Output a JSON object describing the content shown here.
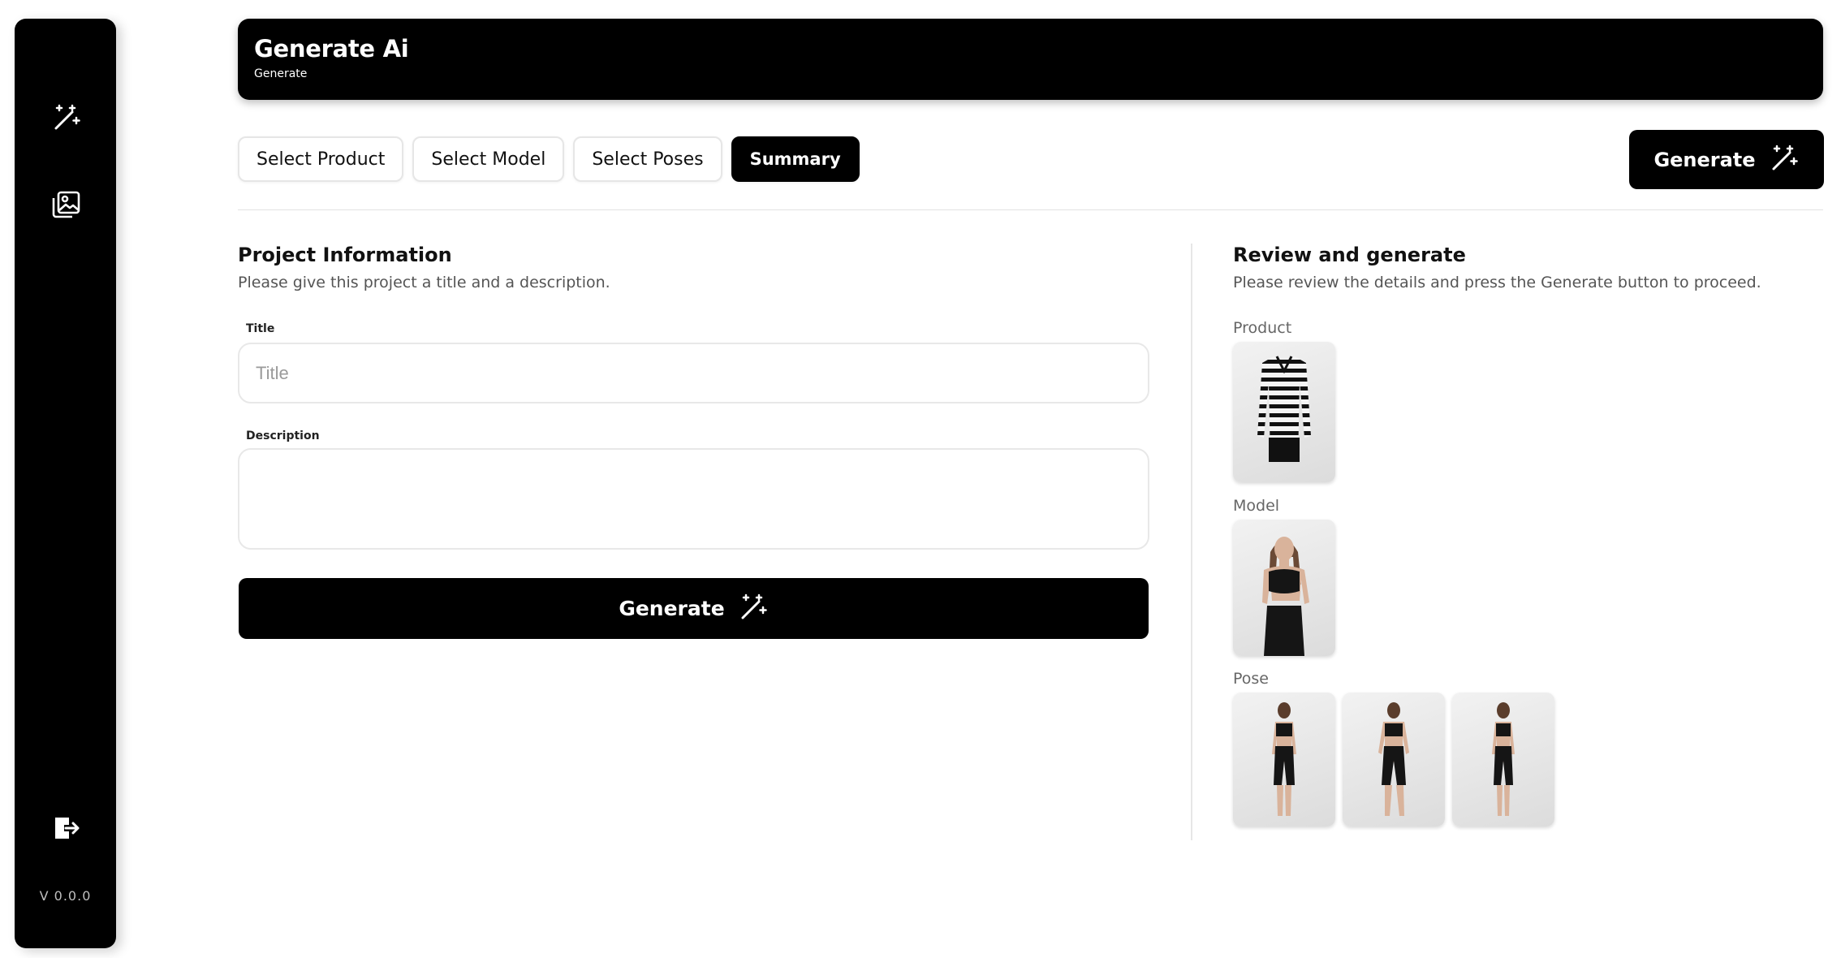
{
  "sidebar": {
    "items": [
      {
        "icon": "magic-wand-icon"
      },
      {
        "icon": "image-gallery-icon"
      }
    ],
    "logout_icon": "logout-icon",
    "version": "V 0.0.0"
  },
  "header": {
    "title": "Generate Ai",
    "subtitle": "Generate"
  },
  "tabs": [
    {
      "label": "Select Product",
      "active": false
    },
    {
      "label": "Select Model",
      "active": false
    },
    {
      "label": "Select Poses",
      "active": false
    },
    {
      "label": "Summary",
      "active": true
    }
  ],
  "toolbar": {
    "generate_label": "Generate"
  },
  "project_info": {
    "title": "Project Information",
    "subtitle": "Please give this project a title and a description.",
    "title_label": "Title",
    "title_placeholder": "Title",
    "title_value": "",
    "description_label": "Description",
    "description_value": "",
    "generate_label": "Generate"
  },
  "review": {
    "title": "Review and generate",
    "subtitle": "Please review the details and press the Generate button to proceed.",
    "product_label": "Product",
    "model_label": "Model",
    "pose_label": "Pose",
    "pose_count": 3
  },
  "colors": {
    "primary": "#000000",
    "background": "#ffffff",
    "border": "#e6e6e6"
  }
}
